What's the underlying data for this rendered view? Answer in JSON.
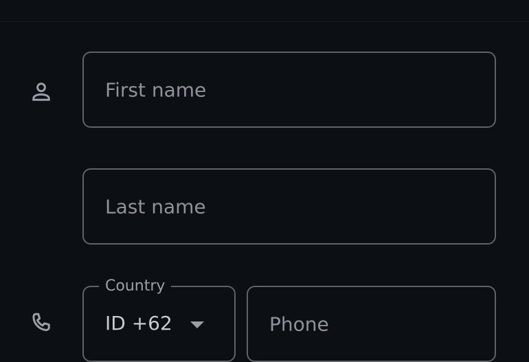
{
  "form": {
    "first_name": {
      "placeholder": "First name"
    },
    "last_name": {
      "placeholder": "Last name"
    },
    "country": {
      "label": "Country",
      "value": "ID +62"
    },
    "phone": {
      "placeholder": "Phone"
    }
  },
  "icons": {
    "person": "person-outline-icon",
    "phone": "phone-outline-icon",
    "caret": "arrow-drop-down-icon"
  },
  "colors": {
    "background": "#0c1014",
    "border": "#5f6368",
    "text": "#9aa0a6"
  }
}
